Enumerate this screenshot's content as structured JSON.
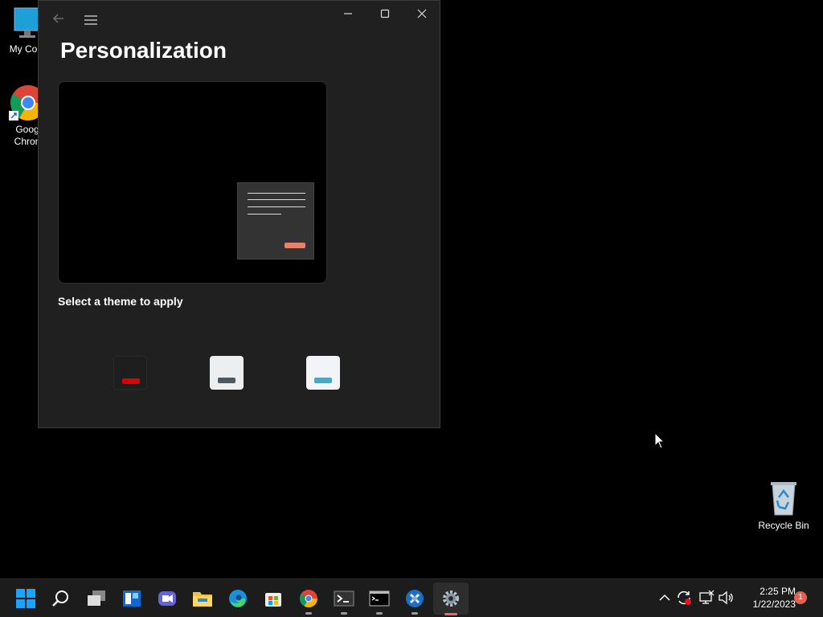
{
  "desktop": {
    "icons": [
      {
        "label": "My Com"
      },
      {
        "label": "Goog\nChron"
      },
      {
        "label": "Recycle Bin"
      }
    ]
  },
  "window": {
    "title": "Personalization",
    "section_label": "Select a theme to apply",
    "themes": [
      {
        "bg": "#1e1e1e",
        "accent": "#e00000"
      },
      {
        "bg": "#eceef0",
        "accent": "#50575f"
      },
      {
        "bg": "#f2f4f7",
        "accent": "#4aa8c0"
      }
    ],
    "preview_button_color": "#e8826a"
  },
  "taskbar": {
    "apps": [
      "start-icon",
      "search-icon",
      "task-view-icon",
      "widgets-icon",
      "chat-icon",
      "file-explorer-icon",
      "edge-icon",
      "store-icon",
      "chrome-icon",
      "terminal-icon",
      "cmd-icon",
      "app-icon",
      "settings-icon"
    ],
    "clock_time": "2:25 PM",
    "clock_date": "1/22/2023",
    "notification_count": "1"
  }
}
